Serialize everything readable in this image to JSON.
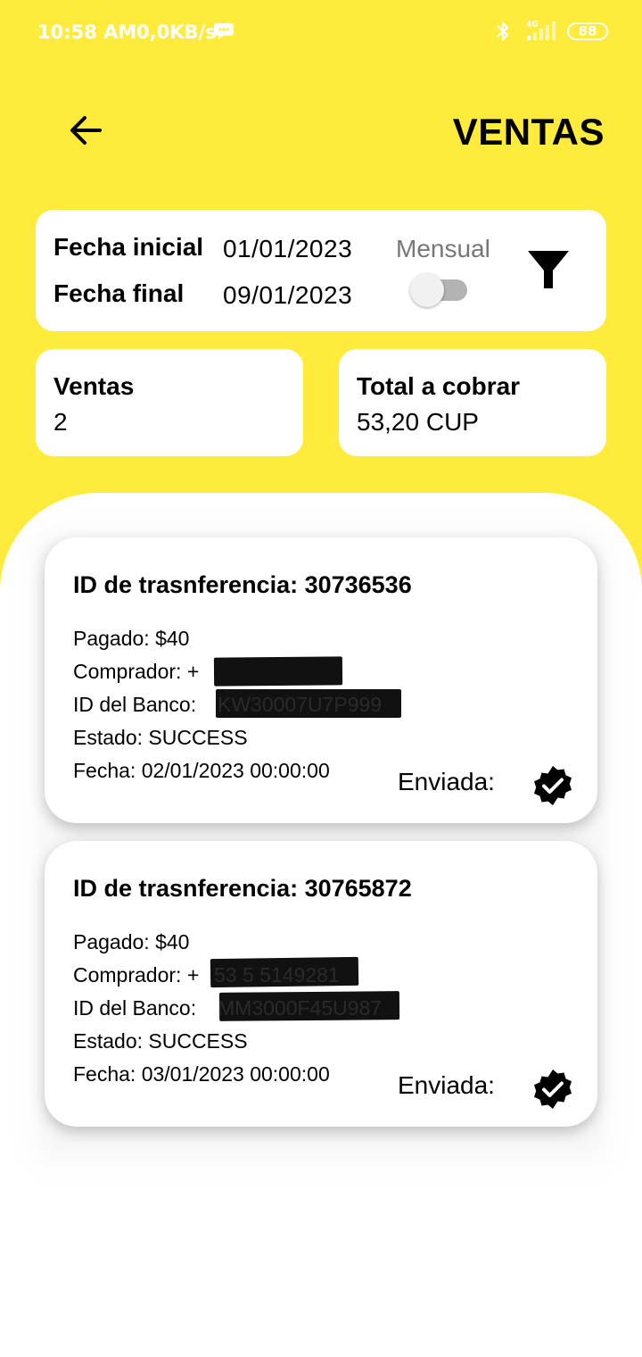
{
  "status_bar": {
    "time": "10:58 AM",
    "speed": "0,0KB/s",
    "network": "4G",
    "battery": "88"
  },
  "header": {
    "title": "VENTAS",
    "back_icon": "arrow-left-icon"
  },
  "filter": {
    "start_label": "Fecha inicial",
    "start_value": "01/01/2023",
    "end_label": "Fecha final",
    "end_value": "09/01/2023",
    "monthly_label": "Mensual",
    "monthly_on": false,
    "filter_icon": "funnel-icon"
  },
  "stats": {
    "sales_label": "Ventas",
    "sales_value": "2",
    "total_label": "Total a cobrar",
    "total_value": "53,20 CUP"
  },
  "transactions": [
    {
      "title": "ID de trasnferencia: 30736536",
      "paid": "Pagado: $40",
      "buyer_label": "Comprador: +",
      "bank_label": "ID del Banco: ",
      "bank_value": "KW30007U7P999",
      "status": "Estado: SUCCESS",
      "date": "Fecha: 02/01/2023 00:00:00",
      "sent_label": "Enviada:"
    },
    {
      "title": "ID de trasnferencia: 30765872",
      "paid": "Pagado: $40",
      "buyer_label": "Comprador: +",
      "buyer_value": "53 5 5149281",
      "bank_label": "ID del Banco: ",
      "bank_value": "MM3000F45U987",
      "status": "Estado: SUCCESS",
      "date": "Fecha: 03/01/2023 00:00:00",
      "sent_label": "Enviada:"
    }
  ]
}
